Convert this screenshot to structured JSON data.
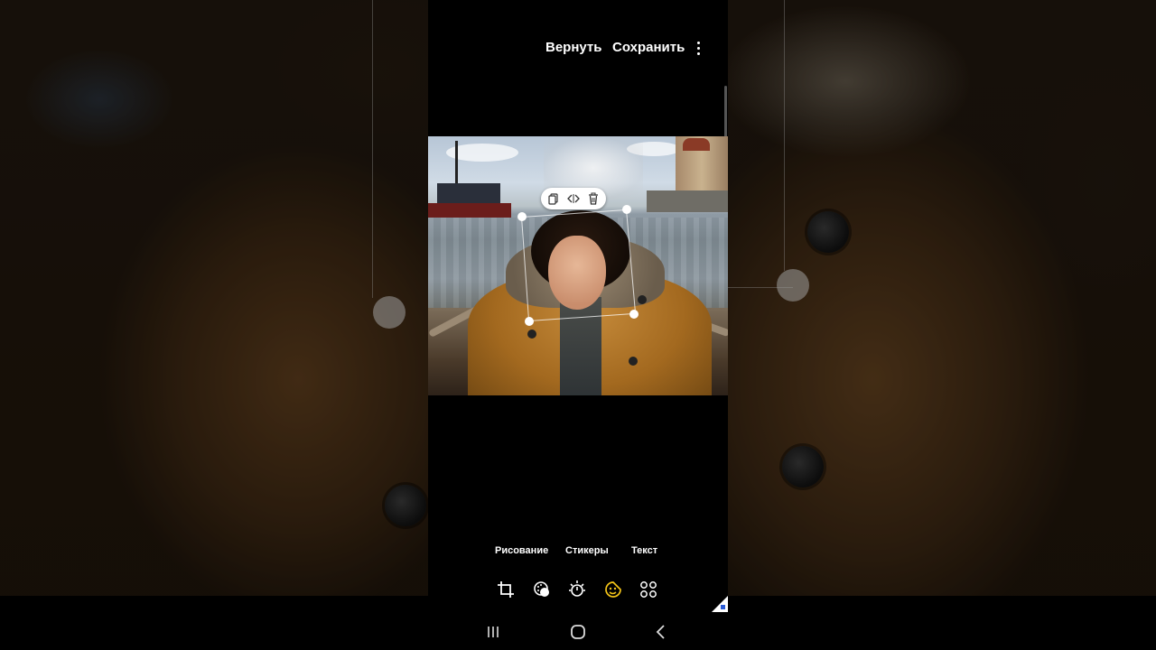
{
  "header": {
    "revert_label": "Вернуть",
    "save_label": "Сохранить",
    "more_icon": "more-vertical-icon"
  },
  "photo_toolbar": {
    "icons": [
      "copy-icon",
      "flip-icon",
      "delete-icon"
    ]
  },
  "tabs": [
    {
      "label": "Рисование"
    },
    {
      "label": "Стикеры"
    },
    {
      "label": "Текст"
    }
  ],
  "tools": [
    {
      "icon": "crop-rotate-icon"
    },
    {
      "icon": "filter-icon"
    },
    {
      "icon": "brightness-icon"
    },
    {
      "icon": "sticker-smile-icon",
      "active": true
    },
    {
      "icon": "more-apps-icon"
    }
  ],
  "navbar": {
    "icons": [
      "recents-icon",
      "home-icon",
      "back-icon"
    ]
  },
  "colors": {
    "active_tool": "#f5c518",
    "text": "#ffffff",
    "background": "#000000"
  }
}
